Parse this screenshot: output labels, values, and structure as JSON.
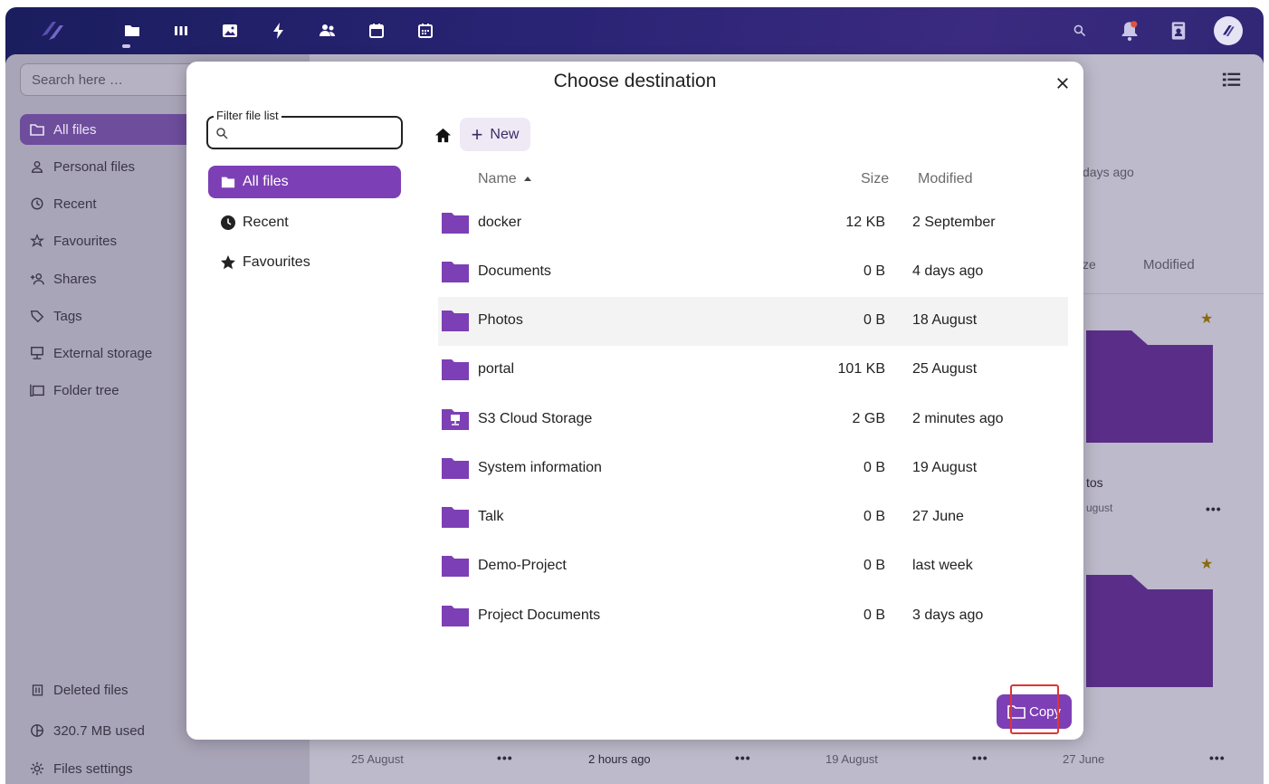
{
  "colors": {
    "accent": "#7d3fb5",
    "header_bg": "#1f1f60",
    "highlight_row": "#f3f3f4",
    "annotation_red": "#e03434",
    "star": "#8a6a10"
  },
  "header": {
    "apps": [
      "files-icon",
      "deck-icon",
      "photos-icon",
      "activity-icon",
      "contacts-icon",
      "calendar-icon",
      "calendar-grid-icon"
    ],
    "right_icons": [
      "search-icon",
      "notifications-icon",
      "contacts-menu-icon"
    ]
  },
  "background": {
    "search_placeholder": "Search here …",
    "nav": [
      {
        "label": "All files",
        "icon": "folder-icon"
      },
      {
        "label": "Personal files",
        "icon": "person-icon"
      },
      {
        "label": "Recent",
        "icon": "history-icon"
      },
      {
        "label": "Favourites",
        "icon": "star-outline-icon"
      },
      {
        "label": "Shares",
        "icon": "share-icon"
      },
      {
        "label": "Tags",
        "icon": "tag-icon"
      },
      {
        "label": "External storage",
        "icon": "external-storage-icon"
      },
      {
        "label": "Folder tree",
        "icon": "folder-tree-icon"
      }
    ],
    "deleted_files": "Deleted files",
    "quota": "320.7 MB used",
    "settings": "Files settings",
    "peek": {
      "days_ago": "days ago",
      "size_col": "ze",
      "modified_col": "Modified",
      "photos_name": "tos",
      "photos_date": "ugust",
      "bottom_dates": [
        "25 August",
        "2 hours ago",
        "19 August",
        "27 June"
      ]
    }
  },
  "dialog": {
    "title": "Choose destination",
    "filter_label": "Filter file list",
    "filter_value": "",
    "nav": [
      {
        "label": "All files",
        "active": true
      },
      {
        "label": "Recent",
        "active": false
      },
      {
        "label": "Favourites",
        "active": false
      }
    ],
    "new_label": "New",
    "columns": {
      "name": "Name",
      "size": "Size",
      "modified": "Modified"
    },
    "rows": [
      {
        "name": "docker",
        "size": "12 KB",
        "modified": "2 September"
      },
      {
        "name": "Documents",
        "size": "0 B",
        "modified": "4 days ago"
      },
      {
        "name": "Photos",
        "size": "0 B",
        "modified": "18 August"
      },
      {
        "name": "portal",
        "size": "101 KB",
        "modified": "25 August"
      },
      {
        "name": "S3 Cloud Storage",
        "size": "2 GB",
        "modified": "2 minutes ago"
      },
      {
        "name": "System information",
        "size": "0 B",
        "modified": "19 August"
      },
      {
        "name": "Talk",
        "size": "0 B",
        "modified": "27 June"
      },
      {
        "name": "Demo-Project",
        "size": "0 B",
        "modified": "last week"
      },
      {
        "name": "Project Documents",
        "size": "0 B",
        "modified": "3 days ago"
      }
    ],
    "copy_label": "Copy"
  }
}
